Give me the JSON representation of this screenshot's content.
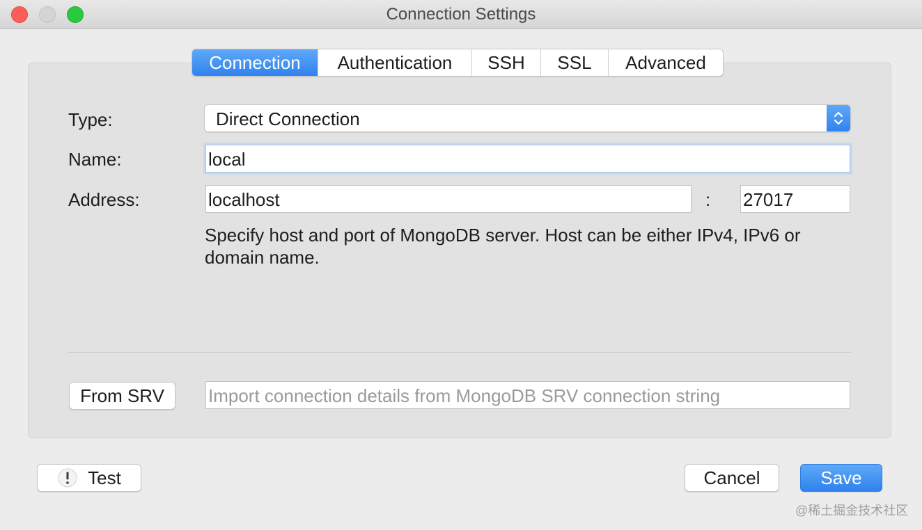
{
  "window": {
    "title": "Connection Settings"
  },
  "tabs": [
    {
      "label": "Connection",
      "active": true
    },
    {
      "label": "Authentication",
      "active": false
    },
    {
      "label": "SSH",
      "active": false
    },
    {
      "label": "SSL",
      "active": false
    },
    {
      "label": "Advanced",
      "active": false
    }
  ],
  "form": {
    "type_label": "Type:",
    "type_value": "Direct Connection",
    "name_label": "Name:",
    "name_value": "local",
    "address_label": "Address:",
    "host_value": "localhost",
    "port_separator": ":",
    "port_value": "27017",
    "hint": "Specify host and port of MongoDB server. Host can be either IPv4, IPv6 or domain name."
  },
  "srv": {
    "button_label": "From SRV",
    "placeholder": "Import connection details from MongoDB SRV connection string"
  },
  "footer": {
    "test_label": "Test",
    "cancel_label": "Cancel",
    "save_label": "Save"
  },
  "watermark": "@稀土掘金技术社区",
  "colors": {
    "accent": "#2f83ee",
    "close": "#fc5f57",
    "maximize": "#29c940"
  },
  "icons": {
    "select_stepper": "up-down-chevron-icon",
    "test": "warning-icon"
  }
}
